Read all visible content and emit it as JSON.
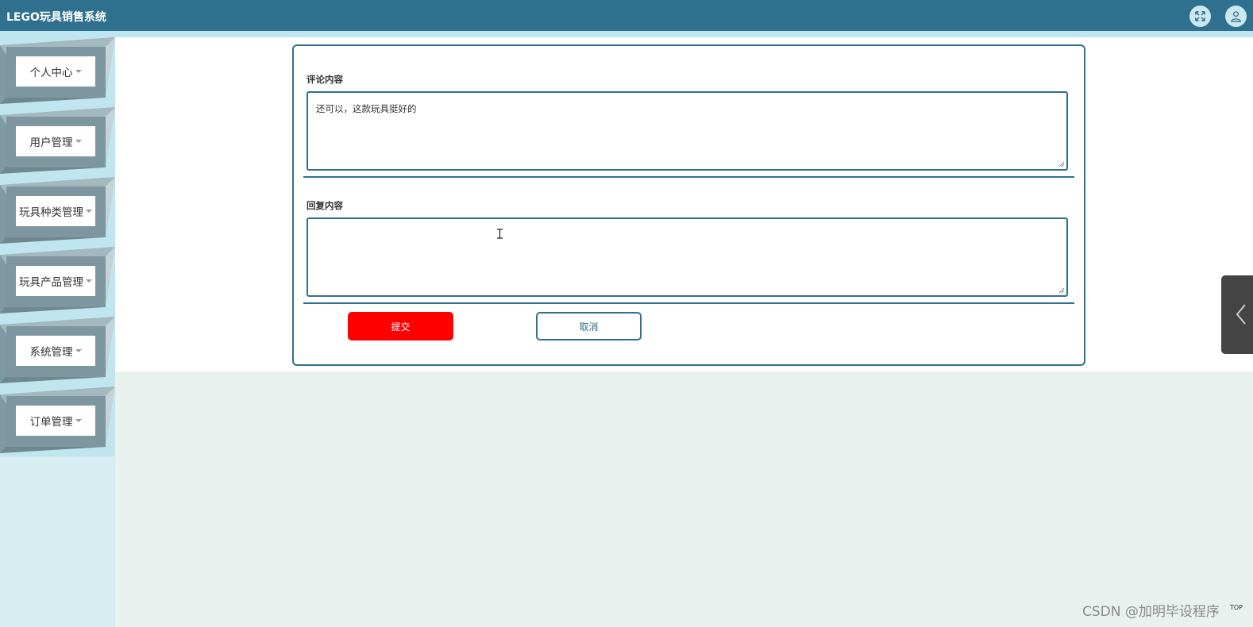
{
  "header": {
    "title": "LEGO玩具销售系统",
    "fullscreen_icon": "fullscreen-icon",
    "user_icon": "user-icon"
  },
  "sidebar": {
    "items": [
      {
        "label": "个人中心"
      },
      {
        "label": "用户管理"
      },
      {
        "label": "玩具种类管理"
      },
      {
        "label": "玩具产品管理"
      },
      {
        "label": "系统管理"
      },
      {
        "label": "订单管理"
      }
    ]
  },
  "form": {
    "comment_label": "评论内容",
    "comment_value": "还可以，这款玩具挺好的",
    "reply_label": "回复内容",
    "reply_value": "",
    "submit_label": "提交",
    "cancel_label": "取消"
  },
  "watermark": "CSDN @加明毕设程序",
  "top_label": "TOP",
  "colors": {
    "header": "#2f708e",
    "submit": "#ff0000",
    "accent": "#2f708e",
    "sidebar": "#bfe6ef"
  }
}
